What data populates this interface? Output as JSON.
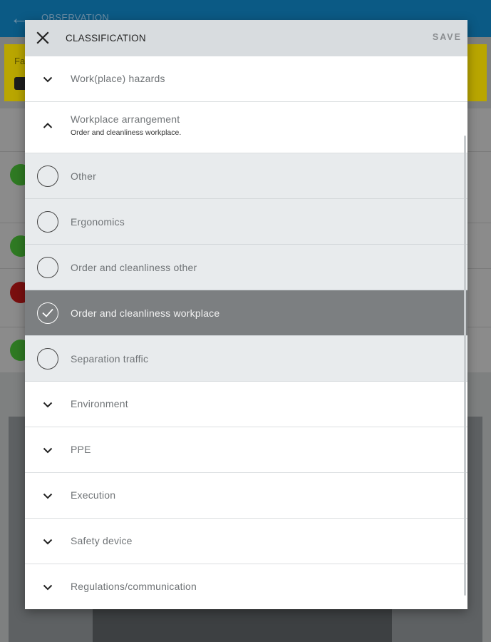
{
  "background": {
    "title": "OBSERVATION",
    "yellow_hint": "Fa"
  },
  "dialog": {
    "title": "CLASSIFICATION",
    "save_label": "SAVE",
    "categories": [
      {
        "label": "Work(place) hazards",
        "expanded": false
      },
      {
        "label": "Workplace arrangement",
        "subtitle": "Order and cleanliness workplace.",
        "expanded": true,
        "options": [
          {
            "label": "Other",
            "selected": false
          },
          {
            "label": "Ergonomics",
            "selected": false
          },
          {
            "label": "Order and cleanliness other",
            "selected": false
          },
          {
            "label": "Order and cleanliness workplace",
            "selected": true
          },
          {
            "label": "Separation traffic",
            "selected": false
          }
        ]
      },
      {
        "label": "Environment",
        "expanded": false
      },
      {
        "label": "PPE",
        "expanded": false
      },
      {
        "label": "Execution",
        "expanded": false
      },
      {
        "label": "Safety device",
        "expanded": false
      },
      {
        "label": "Regulations/communication",
        "expanded": false
      }
    ]
  },
  "colors": {
    "topbar": "#0b5a85",
    "selected_row": "#7c7f81",
    "option_row": "#e8ebed"
  }
}
